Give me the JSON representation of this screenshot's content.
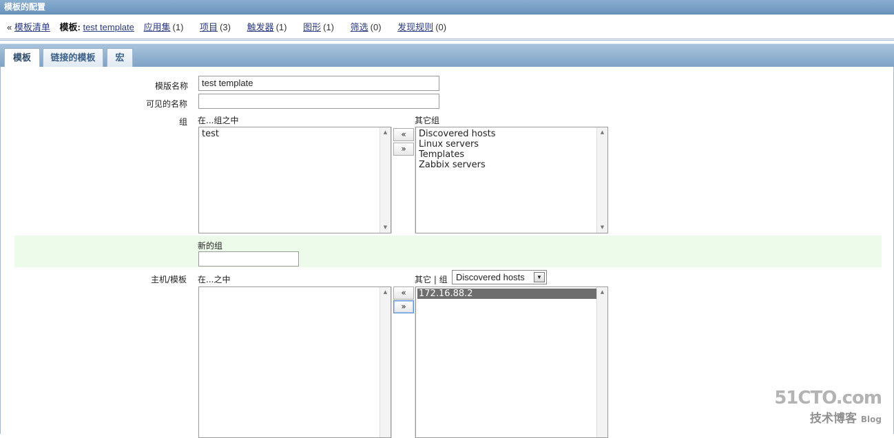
{
  "title": "模板的配置",
  "nav": {
    "back": "« ",
    "template_list": "模板清单",
    "template_label": "模板:",
    "template_name": "test template",
    "apps": "应用集",
    "apps_count": "(1)",
    "items": "项目",
    "items_count": "(3)",
    "triggers": "触发器",
    "triggers_count": "(1)",
    "graphs": "图形",
    "graphs_count": "(1)",
    "screens": "筛选",
    "screens_count": "(0)",
    "discovery": "发现规则",
    "discovery_count": "(0)"
  },
  "tabs": [
    "模板",
    "链接的模板",
    "宏"
  ],
  "form": {
    "template_name_label": "模版名称",
    "template_name_value": "test template",
    "visible_name_label": "可见的名称",
    "visible_name_value": "",
    "groups_label": "组",
    "in_groups_label": "在...组之中",
    "other_groups_label": "其它组",
    "in_groups": [
      "test"
    ],
    "other_groups": [
      "Discovered hosts",
      "Linux servers",
      "Templates",
      "Zabbix servers"
    ],
    "new_group_label": "新的组",
    "new_group_value": "",
    "hosts_label": "主机/模板",
    "in_hosts_label": "在...之中",
    "other_hosts_label": "其它 | 组",
    "group_select": "Discovered hosts",
    "other_hosts": [
      "172.16.88.2"
    ],
    "move_left": "«",
    "move_right": "»"
  },
  "watermark": {
    "site": "51CTO.com",
    "sub": "技术博客",
    "blog": "Blog"
  }
}
